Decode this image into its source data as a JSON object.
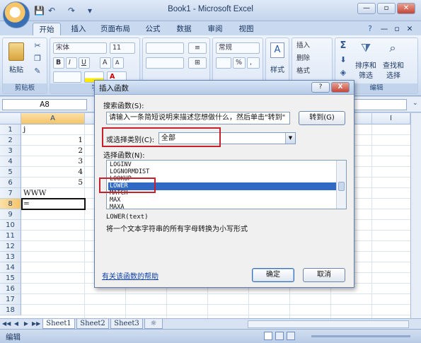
{
  "window": {
    "title": "Book1 - Microsoft Excel",
    "controls": [
      "—",
      "▫",
      "✕"
    ]
  },
  "quick_access": {
    "save_icon": "💾",
    "undo_icon": "↶",
    "redo_icon": "↷",
    "more_icon": "▾"
  },
  "ribbon": {
    "tabs": [
      "开始",
      "插入",
      "页面布局",
      "公式",
      "数据",
      "审阅",
      "视图"
    ],
    "help_icon": "?",
    "doc_controls": [
      "—",
      "▫",
      "✕"
    ],
    "clipboard": {
      "paste_label": "粘贴",
      "group_label": "剪贴板"
    },
    "font": {
      "font_name": "宋体",
      "font_size": "11",
      "bold": "B",
      "italic": "I",
      "underline": "U",
      "grow": "A",
      "shrink": "A",
      "group_label": "字"
    },
    "alignment": {
      "wrap": "≡",
      "merge": "⊞"
    },
    "number": {
      "format": "常规",
      "percent": "%",
      "comma": ","
    },
    "styles": {
      "label": "样式"
    },
    "cells": {
      "insert": "插入",
      "delete": "删除",
      "format": "格式"
    },
    "editing": {
      "sigma": "Σ",
      "sort_filter": "排序和",
      "sort_filter2": "筛选",
      "find_select": "查找和",
      "find_select2": "选择",
      "group_label": "编辑"
    }
  },
  "formula_bar": {
    "name_box": "A8",
    "fx": "fx"
  },
  "grid": {
    "columns": [
      "A",
      "B",
      "C",
      "D",
      "E",
      "F",
      "G",
      "H",
      "I"
    ],
    "rows": [
      "1",
      "2",
      "3",
      "4",
      "5",
      "6",
      "7",
      "8",
      "9",
      "10",
      "11",
      "12",
      "13",
      "14",
      "15",
      "16",
      "17",
      "18"
    ],
    "cells": [
      {
        "row": 1,
        "value": "j"
      },
      {
        "row": 2,
        "value": "1"
      },
      {
        "row": 3,
        "value": "2"
      },
      {
        "row": 4,
        "value": "3"
      },
      {
        "row": 5,
        "value": "4"
      },
      {
        "row": 6,
        "value": "5"
      },
      {
        "row": 7,
        "value": "WWW"
      },
      {
        "row": 8,
        "value": "="
      }
    ],
    "active_cell": "A8"
  },
  "sheets": {
    "tabs": [
      "Sheet1",
      "Sheet2",
      "Sheet3"
    ],
    "new_sheet_icon": "☼"
  },
  "status": {
    "mode": "编辑"
  },
  "dialog": {
    "title": "插入函数",
    "help_btn": "?",
    "close_btn": "X",
    "search_label": "搜索函数(S):",
    "search_value": "请输入一条简短说明来描述您想做什么，然后单击\"转到\"",
    "go_button": "转到(G)",
    "category_label": "或选择类别(C):",
    "category_value": "全部",
    "function_list_label": "选择函数(N):",
    "functions": [
      "LOGINV",
      "LOGNORMDIST",
      "LOOKUP",
      "LOWER",
      "MATCH",
      "MAX",
      "MAXA"
    ],
    "selected_function": "LOWER",
    "signature": "LOWER(text)",
    "description": "将一个文本字符串的所有字母转换为小写形式",
    "help_link": "有关该函数的帮助",
    "ok_button": "确定",
    "cancel_button": "取消",
    "highlight_color": "#c8202a"
  }
}
